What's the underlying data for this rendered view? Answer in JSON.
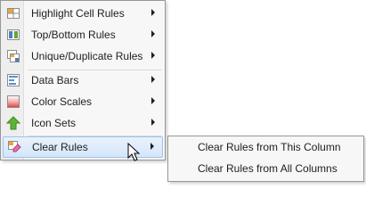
{
  "menu": {
    "items": [
      {
        "label": "Highlight Cell Rules",
        "icon": "highlight-cell-rules-icon",
        "submenu": true
      },
      {
        "label": "Top/Bottom Rules",
        "icon": "top-bottom-rules-icon",
        "submenu": true
      },
      {
        "label": "Unique/Duplicate Rules",
        "icon": "unique-duplicate-rules-icon",
        "submenu": true
      },
      {
        "label": "Data Bars",
        "icon": "data-bars-icon",
        "submenu": true
      },
      {
        "label": "Color Scales",
        "icon": "color-scales-icon",
        "submenu": true
      },
      {
        "label": "Icon Sets",
        "icon": "icon-sets-icon",
        "submenu": true
      },
      {
        "label": "Clear Rules",
        "icon": "clear-rules-icon",
        "submenu": true,
        "highlighted": true
      }
    ]
  },
  "submenu": {
    "items": [
      {
        "label": "Clear Rules from This Column"
      },
      {
        "label": "Clear Rules from All Columns"
      }
    ]
  },
  "colors": {
    "highlight_bg": "#d4e6fb",
    "highlight_border": "#9dc2ef",
    "menu_bg": "#f7f7f7"
  }
}
